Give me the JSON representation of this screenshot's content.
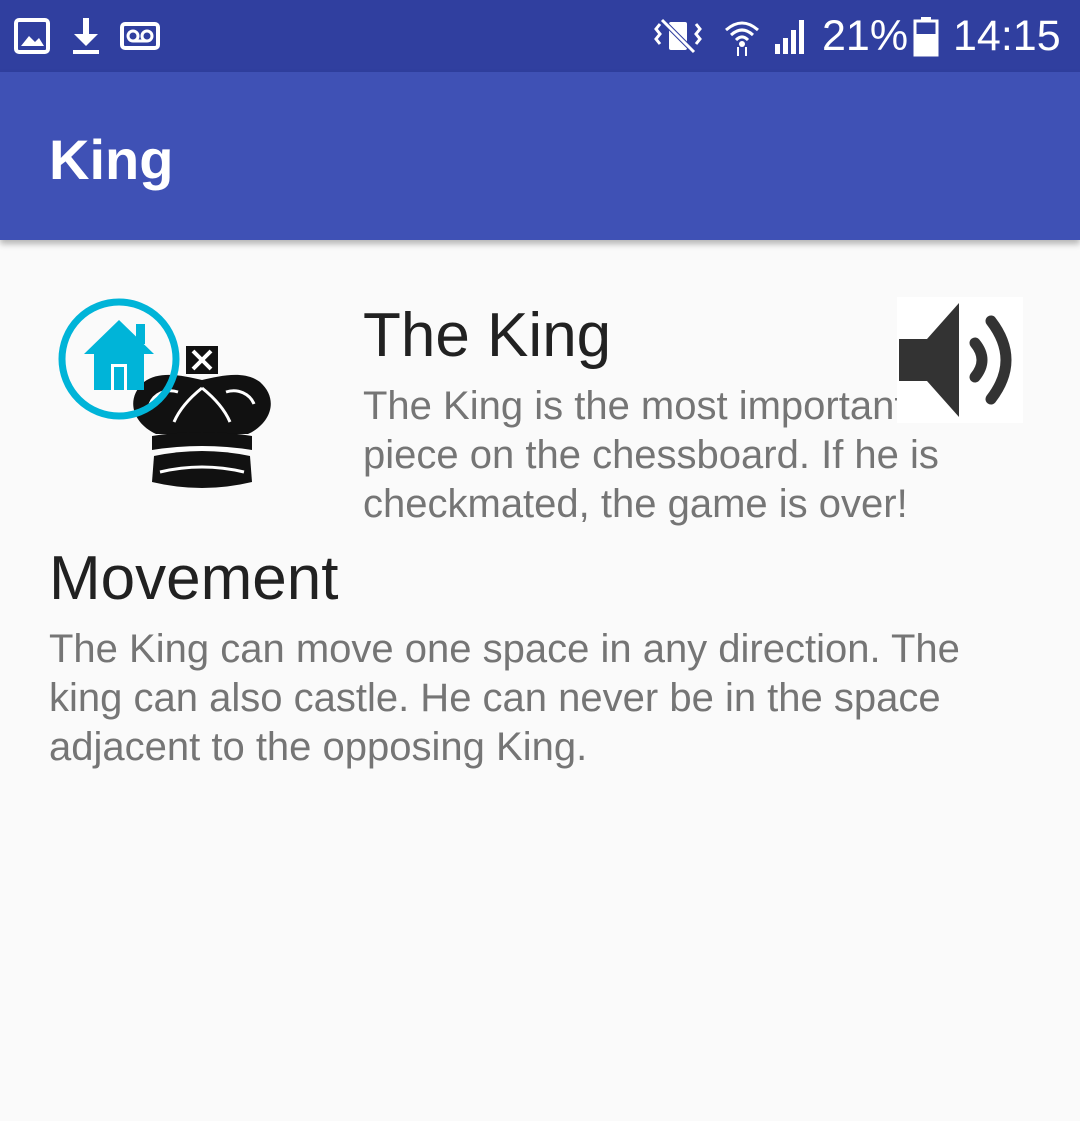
{
  "status_bar": {
    "left_icons": [
      "gallery-icon",
      "download-icon",
      "voicemail-icon"
    ],
    "right_icons": [
      "vibrate-icon",
      "wifi-icon",
      "signal-icon",
      "battery-icon"
    ],
    "battery_percent": "21%",
    "time": "14:15"
  },
  "app_bar": {
    "title": "King",
    "color": "#3f51b5",
    "status_color": "#303f9f"
  },
  "piece": {
    "image": "chess-king-icon",
    "home_icon": "home-icon",
    "home_color": "#00b4d8",
    "sound_icon": "speaker-icon"
  },
  "content": {
    "title": "The King",
    "description": "The King is the most important chess piece on the chessboard. If he is checkmated, the game is over!",
    "movement_title": "Movement",
    "movement_text": "The King can move one space in any direction. The king can also castle. He can never be in the space adjacent to the opposing King."
  }
}
